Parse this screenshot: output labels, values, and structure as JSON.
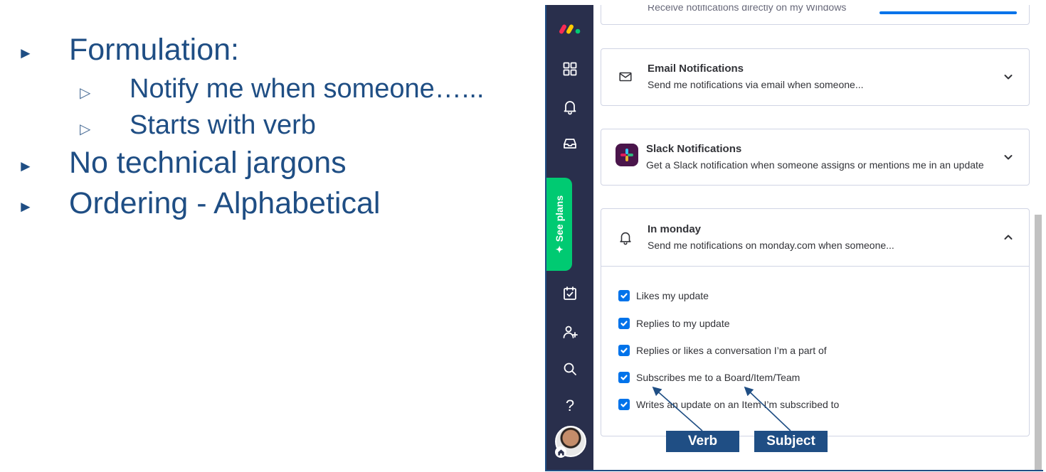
{
  "slide": {
    "bullets": [
      {
        "level": 1,
        "marker": "►",
        "text": "Formulation:"
      },
      {
        "level": 2,
        "marker": "▷",
        "text": "Notify me when someone…..."
      },
      {
        "level": 2,
        "marker": "▷",
        "text": "Starts with verb"
      },
      {
        "level": 1,
        "marker": "►",
        "text": "No technical jargons"
      },
      {
        "level": 1,
        "marker": "►",
        "text": "Ordering - Alphabetical"
      }
    ],
    "text_color": "#1f4e84"
  },
  "app": {
    "rail": {
      "background": "#292f4c",
      "icons": [
        "monday-logo-icon",
        "grid-icon",
        "bell-icon",
        "inbox-icon",
        "calendar-check-icon",
        "add-user-icon",
        "search-icon",
        "help-icon"
      ],
      "see_plans": {
        "label": "See plans",
        "color": "#00ca72"
      },
      "help_glyph": "?"
    },
    "top_card": {
      "subtitle": "Receive notifications directly on my Windows"
    },
    "cards": [
      {
        "id": "email",
        "icon": "mail-icon",
        "title": "Email Notifications",
        "subtitle": "Send me notifications via email when someone...",
        "expanded": false
      },
      {
        "id": "slack",
        "icon": "slack-icon",
        "title": "Slack Notifications",
        "subtitle": "Get a Slack notification when someone assigns or mentions me in an update",
        "expanded": false
      },
      {
        "id": "monday",
        "icon": "bell-icon",
        "title": "In monday",
        "subtitle": "Send me notifications on monday.com when someone...",
        "expanded": true,
        "options": [
          {
            "label": "Likes my update",
            "checked": true
          },
          {
            "label": "Replies to my update",
            "checked": true
          },
          {
            "label": "Replies or likes a conversation I’m a part of",
            "checked": true
          },
          {
            "label": "Subscribes me to a Board/Item/Team",
            "checked": true
          },
          {
            "label": "Writes an update on an Item I’m subscribed to",
            "checked": true
          }
        ]
      }
    ],
    "checkbox_color": "#0073ea"
  },
  "annotations": {
    "verb": "Verb",
    "subject": "Subject",
    "color": "#1f4e84"
  }
}
